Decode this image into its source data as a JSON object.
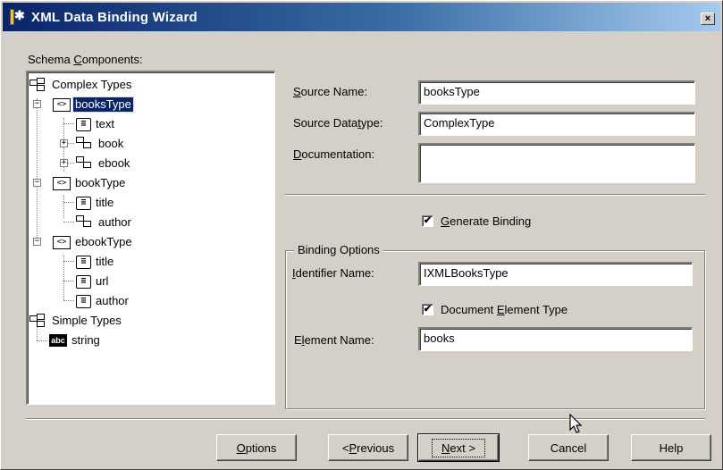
{
  "window": {
    "title": "XML Data Binding Wizard",
    "close_glyph": "×"
  },
  "schema": {
    "label_pre": "Schema ",
    "label_u": "C",
    "label_post": "omponents:",
    "tree": {
      "complex_types": "Complex Types",
      "booksType": "booksType",
      "books_text": "text",
      "books_book": "book",
      "books_ebook": "ebook",
      "bookType": "bookType",
      "book_title": "title",
      "book_author": "author",
      "ebookType": "ebookType",
      "ebook_title": "title",
      "ebook_url": "url",
      "ebook_author": "author",
      "simple_types": "Simple Types",
      "string": "string",
      "abc_glyph": "abc"
    }
  },
  "details": {
    "source_name_pre": "",
    "source_name_u": "S",
    "source_name_post": "ource Name:",
    "source_name_value": "booksType",
    "source_datatype_pre": "Source Data",
    "source_datatype_u": "t",
    "source_datatype_post": "ype:",
    "source_datatype_value": "ComplexType",
    "documentation_pre": "",
    "documentation_u": "D",
    "documentation_post": "ocumentation:",
    "documentation_value": ""
  },
  "generate": {
    "checked": true,
    "check_glyph": "✔",
    "label_pre": "",
    "label_u": "G",
    "label_post": "enerate Binding"
  },
  "binding_options": {
    "group_title": "Binding Options",
    "identifier_pre": "",
    "identifier_u": "I",
    "identifier_post": "dentifier Name:",
    "identifier_value": "IXMLBooksType",
    "doc_element_checked": true,
    "doc_element_pre": "Document ",
    "doc_element_u": "E",
    "doc_element_post": "lement Type",
    "element_name_pre": "E",
    "element_name_u": "l",
    "element_name_post": "ement Name:",
    "element_name_value": "books"
  },
  "buttons": {
    "options_pre": "",
    "options_u": "O",
    "options_post": "ptions",
    "previous_pre": "< ",
    "previous_u": "P",
    "previous_post": "revious",
    "next_pre": "",
    "next_u": "N",
    "next_post": "ext >",
    "cancel": "Cancel",
    "help": "Help"
  }
}
